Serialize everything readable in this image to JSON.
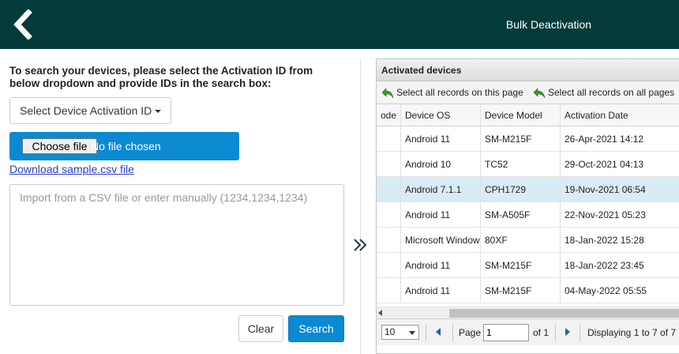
{
  "header": {
    "title": "Bulk Deactivation",
    "back_icon": "chevron-left-icon",
    "background": "#033b3a"
  },
  "left": {
    "instructions": "To search your devices, please select the Activation ID from below dropdown and provide IDs in the search box:",
    "dropdown_label": "Select Device Activation ID",
    "choose_file_label": "Choose file",
    "file_status": "No file chosen",
    "sample_link": "Download sample.csv file",
    "textarea_placeholder": "Import from a CSV file or enter manually (1234,1234,1234)",
    "clear_label": "Clear",
    "search_label": "Search",
    "accent_color": "#0b8ad1"
  },
  "panel": {
    "title": "Activated devices",
    "select_page_label": "Select all records on this page",
    "select_all_label": "Select all records on all pages",
    "columns": [
      "ode",
      "Device OS",
      "Device Model",
      "Activation Date"
    ],
    "rows": [
      {
        "code": "",
        "os": "Android 11",
        "model": "SM-M215F",
        "date": "26-Apr-2021 14:12",
        "selected": false
      },
      {
        "code": "",
        "os": "Android 10",
        "model": "TC52",
        "date": "29-Oct-2021 04:13",
        "selected": false
      },
      {
        "code": "",
        "os": "Android 7.1.1",
        "model": "CPH1729",
        "date": "19-Nov-2021 06:54",
        "selected": true
      },
      {
        "code": "",
        "os": "Android 11",
        "model": "SM-A505F",
        "date": "22-Nov-2021 05:23",
        "selected": false
      },
      {
        "code": "",
        "os": "Microsoft Windows",
        "model": "80XF",
        "date": "18-Jan-2022 15:28",
        "selected": false
      },
      {
        "code": "",
        "os": "Android 11",
        "model": "SM-M215F",
        "date": "18-Jan-2022 23:45",
        "selected": false
      },
      {
        "code": "",
        "os": "Android 11",
        "model": "SM-M215F",
        "date": "04-May-2022 05:55",
        "selected": false
      }
    ],
    "pager": {
      "page_size": "10",
      "page_label": "Page",
      "page_value": "1",
      "of_label": "of 1",
      "displaying": "Displaying 1 to 7 of 7"
    }
  }
}
